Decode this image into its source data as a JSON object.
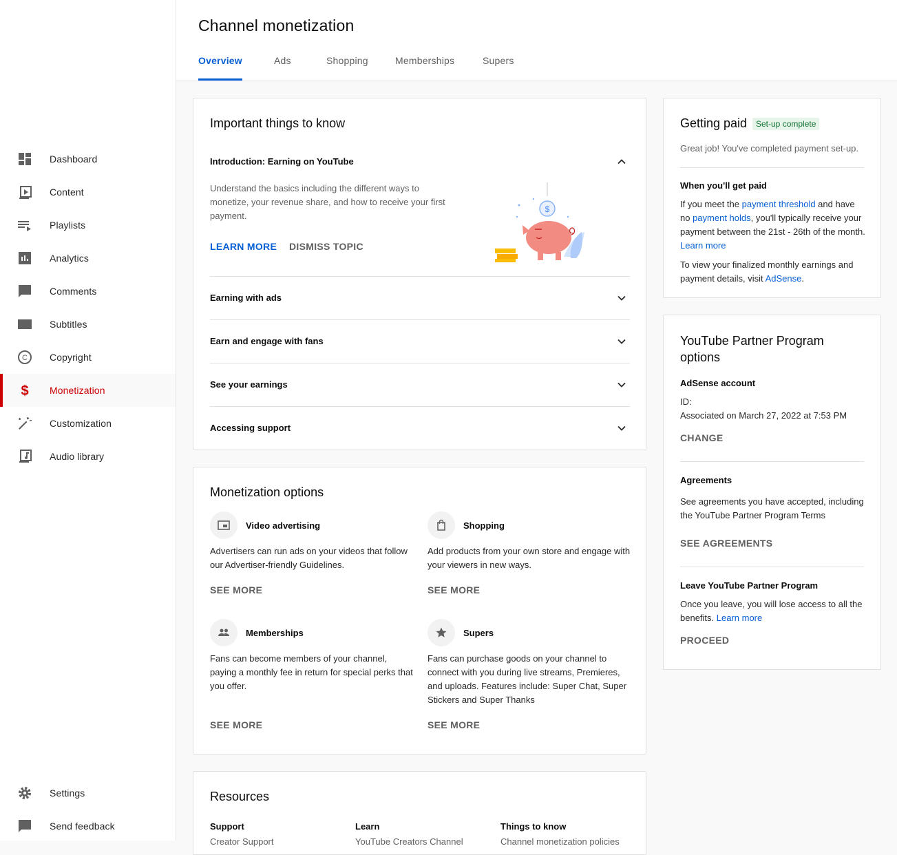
{
  "sidebar": {
    "items": [
      {
        "label": "Dashboard",
        "icon": "dashboard-icon"
      },
      {
        "label": "Content",
        "icon": "content-icon"
      },
      {
        "label": "Playlists",
        "icon": "playlists-icon"
      },
      {
        "label": "Analytics",
        "icon": "analytics-icon"
      },
      {
        "label": "Comments",
        "icon": "comments-icon"
      },
      {
        "label": "Subtitles",
        "icon": "subtitles-icon"
      },
      {
        "label": "Copyright",
        "icon": "copyright-icon"
      },
      {
        "label": "Monetization",
        "icon": "dollar-icon",
        "active": true
      },
      {
        "label": "Customization",
        "icon": "magic-wand-icon"
      },
      {
        "label": "Audio library",
        "icon": "audio-library-icon"
      }
    ],
    "bottom": [
      {
        "label": "Settings",
        "icon": "gear-icon"
      },
      {
        "label": "Send feedback",
        "icon": "feedback-icon"
      }
    ]
  },
  "header": {
    "title": "Channel monetization",
    "tabs": [
      "Overview",
      "Ads",
      "Shopping",
      "Memberships",
      "Supers"
    ],
    "active_tab": "Overview"
  },
  "important": {
    "title": "Important things to know",
    "intro": {
      "title": "Introduction: Earning on YouTube",
      "body": "Understand the basics including the different ways to monetize, your revenue share, and how to receive your first payment.",
      "learn_more": "LEARN MORE",
      "dismiss": "DISMISS TOPIC"
    },
    "topics": [
      "Earning with ads",
      "Earn and engage with fans",
      "See your earnings",
      "Accessing support"
    ]
  },
  "monetization_options": {
    "title": "Monetization options",
    "options": [
      {
        "title": "Video advertising",
        "icon": "video-ad-icon",
        "desc": "Advertisers can run ads on your videos that follow our Advertiser-friendly Guidelines.",
        "cta": "SEE MORE"
      },
      {
        "title": "Shopping",
        "icon": "shopping-bag-icon",
        "desc": "Add products from your own store and engage with your viewers in new ways.",
        "cta": "SEE MORE"
      },
      {
        "title": "Memberships",
        "icon": "members-icon",
        "desc": "Fans can become members of your channel, paying a monthly fee in return for special perks that you offer.",
        "cta": "SEE MORE"
      },
      {
        "title": "Supers",
        "icon": "star-icon",
        "desc": "Fans can purchase goods on your channel to connect with you during live streams, Premieres, and uploads. Features include: Super Chat, Super Stickers and Super Thanks",
        "cta": "SEE MORE"
      }
    ]
  },
  "resources": {
    "title": "Resources",
    "columns": [
      {
        "title": "Support",
        "link": "Creator Support"
      },
      {
        "title": "Learn",
        "link": "YouTube Creators Channel"
      },
      {
        "title": "Things to know",
        "link": "Channel monetization policies"
      }
    ]
  },
  "getting_paid": {
    "title": "Getting paid",
    "badge": "Set-up complete",
    "subtitle": "Great job! You've completed payment set-up.",
    "when_title": "When you'll get paid",
    "when_p1_a": "If you meet the ",
    "when_link1": "payment threshold",
    "when_p1_b": " and have no ",
    "when_link2": "payment holds",
    "when_p1_c": ", you'll typically receive your payment between the 21st - 26th of the month. ",
    "when_link3": "Learn more",
    "when_p2_a": "To view your finalized monthly earnings and payment details, visit ",
    "when_link4": "AdSense",
    "when_p2_b": "."
  },
  "ypp": {
    "title": "YouTube Partner Program options",
    "adsense_title": "AdSense account",
    "adsense_id": "ID:",
    "adsense_assoc": "Associated on March 27, 2022 at 7:53 PM",
    "change": "CHANGE",
    "agreements_title": "Agreements",
    "agreements_desc": "See agreements you have accepted, including the YouTube Partner Program Terms",
    "see_agreements": "SEE AGREEMENTS",
    "leave_title": "Leave YouTube Partner Program",
    "leave_desc": "Once you leave, you will lose access to all the benefits. ",
    "leave_link": "Learn more",
    "proceed": "PROCEED"
  },
  "colors": {
    "accent": "#065fd4",
    "active_nav": "#cc0000",
    "badge_bg": "#e6f4ea",
    "badge_text": "#137333",
    "piggy": "#f28b82"
  }
}
